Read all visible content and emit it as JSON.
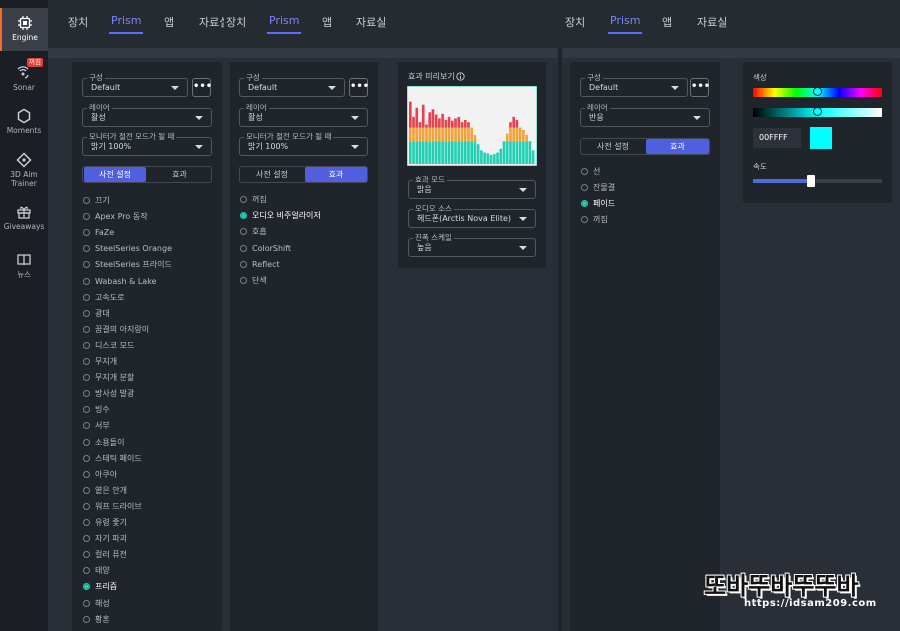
{
  "sidebar": {
    "items": [
      {
        "label": "Engine",
        "icon": "chip-icon",
        "active": true
      },
      {
        "label": "Sonar",
        "icon": "sonar-icon",
        "badge": "꺼짐"
      },
      {
        "label": "Moments",
        "icon": "hexagon-icon"
      },
      {
        "label": "3D Aim Trainer",
        "icon": "crosshair-icon"
      },
      {
        "label": "Giveaways",
        "icon": "gift-icon"
      },
      {
        "label": "뉴스",
        "icon": "book-icon"
      }
    ]
  },
  "topbar1": {
    "tabs": [
      "장치",
      "Prism",
      "앱",
      "자료실"
    ],
    "active": "Prism"
  },
  "topbar2": {
    "tabs": [
      "장치",
      "Prism",
      "앱",
      "자료실"
    ],
    "active": "Prism"
  },
  "topbar3": {
    "tabs": [
      "장치",
      "Prism",
      "앱",
      "자료실"
    ],
    "active": "Prism"
  },
  "panel1": {
    "config_label": "구성",
    "config_value": "Default",
    "more": "•••",
    "layer_label": "레이어",
    "layer_value": "활성",
    "monitor_label": "모니터가 절전 모드가 될 때",
    "monitor_value": "밝기 100%",
    "seg": [
      "사전 설정",
      "효과"
    ],
    "seg_active": 0,
    "presets": [
      "끄기",
      "Apex Pro 동작",
      "FaZe",
      "SteelSeries Orange",
      "SteelSeries 프라이드",
      "Wabash & Lake",
      "고속도로",
      "광대",
      "꿈결의 아지랑이",
      "디스코 모드",
      "무지개",
      "무지개 분할",
      "방사성 발광",
      "빙수",
      "서부",
      "소용돌이",
      "스태틱 페이드",
      "아쿠아",
      "옅은 안개",
      "워프 드라이브",
      "유령 좇기",
      "자기 파괴",
      "컬러 퓨전",
      "태양",
      "프리즘",
      "해성",
      "황혼"
    ],
    "selected": "프리즘"
  },
  "panel2": {
    "config_label": "구성",
    "config_value": "Default",
    "more": "•••",
    "layer_label": "레이어",
    "layer_value": "활성",
    "monitor_label": "모니터가 절전 모드가 될 때",
    "monitor_value": "밝기 100%",
    "seg": [
      "사전 설정",
      "효과"
    ],
    "seg_active": 1,
    "effects": [
      "꺼짐",
      "오디오 비주얼라이저",
      "호흡",
      "ColorShift",
      "Reflect",
      "단색"
    ],
    "selected": "오디오 비주얼라이저"
  },
  "preview": {
    "title": "효과 미리보기",
    "mode_label": "효과 모드",
    "mode_value": "밝음",
    "source_label": "오디오 소스",
    "source_value": "헤드폰(Arctis Nova Elite)",
    "scale_label": "진폭 스케일",
    "scale_value": "높음",
    "colors": {
      "low": "#1fd0b4",
      "mid": "#f2a33a",
      "high": "#e8404e",
      "bg": "#f2f2f2"
    },
    "levels": [
      0.82,
      0.62,
      0.74,
      0.55,
      0.78,
      0.52,
      0.68,
      0.72,
      0.65,
      0.6,
      0.66,
      0.58,
      0.62,
      0.57,
      0.6,
      0.62,
      0.55,
      0.58,
      0.55,
      0.48,
      0.38,
      0.26,
      0.18,
      0.15,
      0.14,
      0.12,
      0.13,
      0.15,
      0.2,
      0.3,
      0.4,
      0.55,
      0.62,
      0.58,
      0.48,
      0.45,
      0.38,
      0.3,
      0.18
    ]
  },
  "panel3": {
    "config_label": "구성",
    "config_value": "Default",
    "more": "•••",
    "layer_label": "레이어",
    "layer_value": "반응",
    "seg": [
      "사전 설정",
      "효과"
    ],
    "seg_active": 1,
    "effects": [
      "선",
      "잔물결",
      "페이드",
      "꺼짐"
    ],
    "selected": "페이드"
  },
  "color_panel": {
    "color_label": "색상",
    "hex": "00FFFF",
    "swatch": "#00ffff",
    "hue_position": 0.5,
    "shade_position": 0.5,
    "speed_label": "속도",
    "speed_value": 0.45
  },
  "watermark": {
    "text": "또바뚜바뚜뚜바",
    "url": "https://idsam209.com"
  }
}
